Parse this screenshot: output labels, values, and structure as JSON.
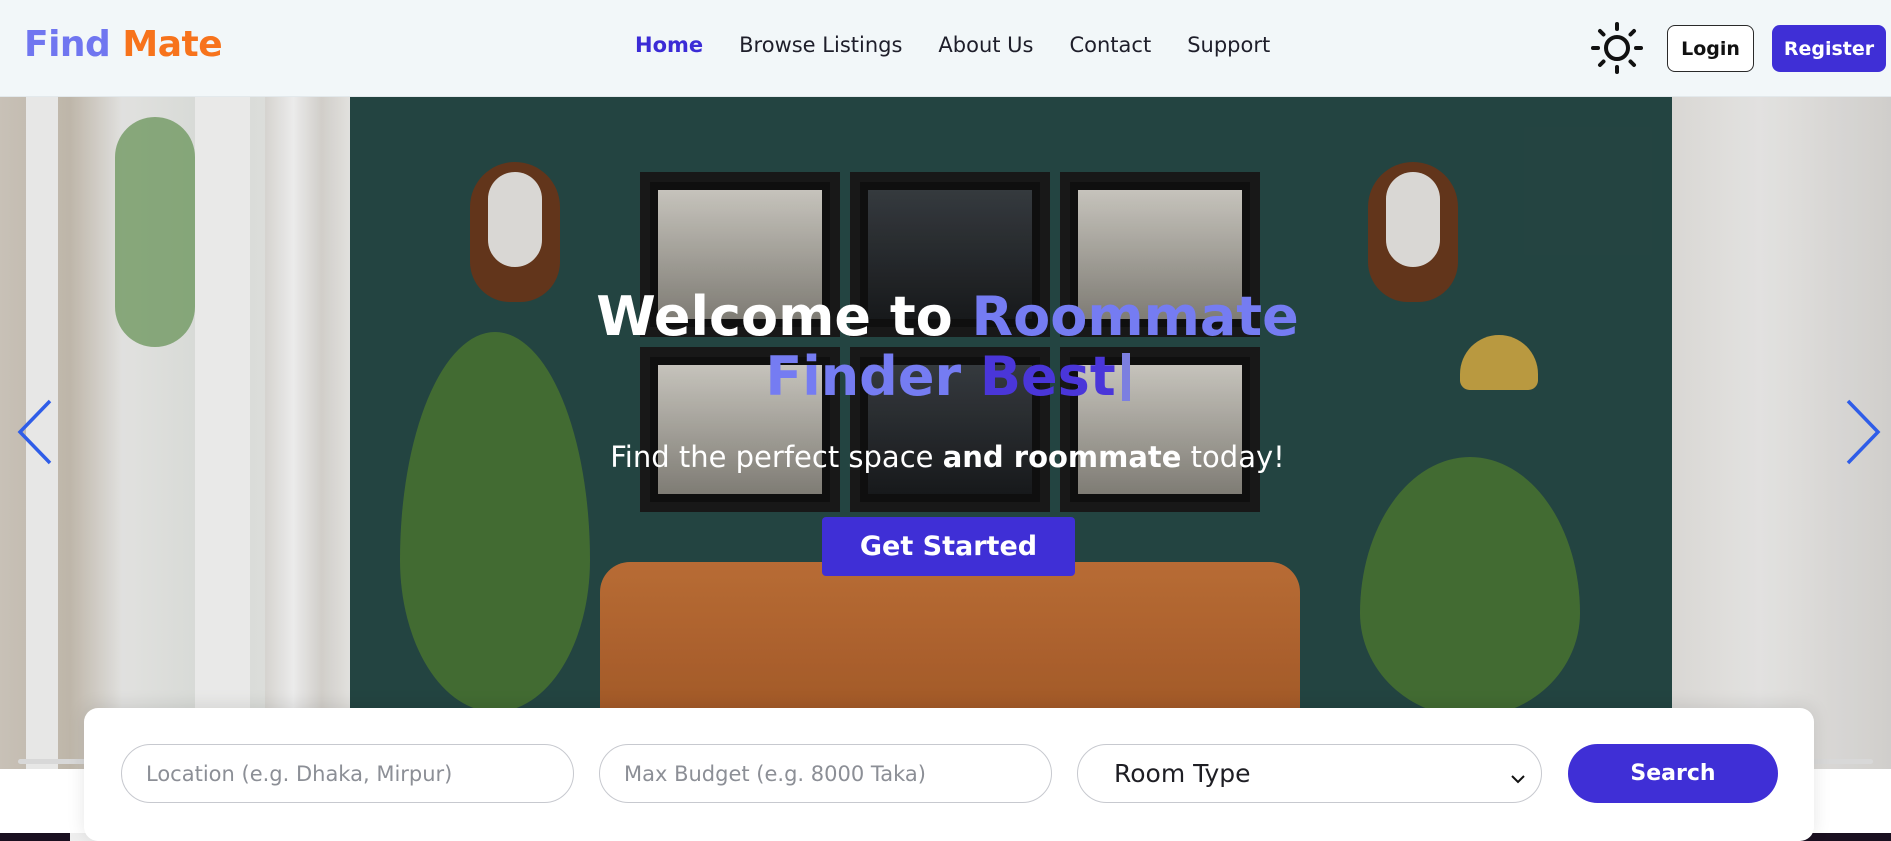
{
  "brand": {
    "part1": "Find",
    "part2": "Mate"
  },
  "nav": {
    "items": [
      {
        "label": "Home",
        "active": true
      },
      {
        "label": "Browse Listings",
        "active": false
      },
      {
        "label": "About Us",
        "active": false
      },
      {
        "label": "Contact",
        "active": false
      },
      {
        "label": "Support",
        "active": false
      }
    ],
    "theme_icon": "sun-icon",
    "login_label": "Login",
    "register_label": "Register"
  },
  "hero": {
    "title_white": "Welcome to ",
    "title_highlight_1": "Roommate Finder",
    "title_highlight_2": " Best",
    "subtitle_normal": "Find the perfect space ",
    "subtitle_bold": "and roommate",
    "subtitle_end": " today!",
    "cta_label": "Get Started",
    "prev_icon": "chevron-left-icon",
    "next_icon": "chevron-right-icon"
  },
  "search": {
    "location_placeholder": "Location (e.g. Dhaka, Mirpur)",
    "budget_placeholder": "Max Budget (e.g. 8000 Taka)",
    "room_type_selected": "Room Type",
    "search_label": "Search"
  },
  "colors": {
    "accent": "#3f2fd6",
    "brand_blue": "#7076f0",
    "brand_orange": "#f7731c",
    "nav_bg": "#f2f7f9"
  }
}
